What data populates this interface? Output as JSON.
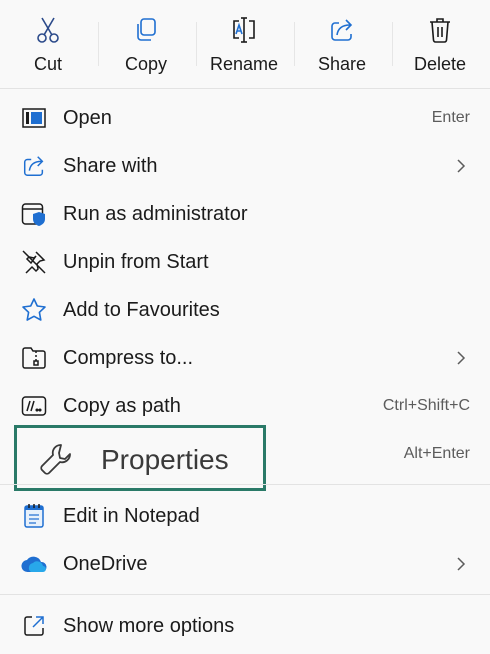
{
  "toolbar": {
    "cut_label": "Cut",
    "copy_label": "Copy",
    "rename_label": "Rename",
    "share_label": "Share",
    "delete_label": "Delete"
  },
  "menu": {
    "items": [
      {
        "label": "Open",
        "shortcut": "Enter",
        "icon": "open-icon"
      },
      {
        "label": "Share with",
        "icon": "share-icon",
        "submenu": true
      },
      {
        "label": "Run as administrator",
        "icon": "shield-icon"
      },
      {
        "label": "Unpin from Start",
        "icon": "unpin-icon"
      },
      {
        "label": "Add to Favourites",
        "icon": "star-icon"
      },
      {
        "label": "Compress to...",
        "icon": "zip-icon",
        "submenu": true
      },
      {
        "label": "Copy as path",
        "shortcut": "Ctrl+Shift+C",
        "icon": "path-icon"
      },
      {
        "label": "Properties",
        "shortcut": "Alt+Enter",
        "icon": "wrench-icon",
        "highlighted": true
      },
      {
        "label": "Edit in Notepad",
        "icon": "notepad-icon"
      },
      {
        "label": "OneDrive",
        "icon": "cloud-icon",
        "submenu": true
      },
      {
        "label": "Show more options",
        "icon": "external-icon"
      }
    ]
  },
  "colors": {
    "accent": "#0f6cbd",
    "highlight_border": "#2a7a68",
    "background": "#f9f9f9"
  }
}
